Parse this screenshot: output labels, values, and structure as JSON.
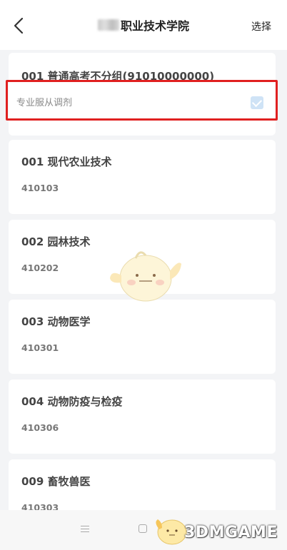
{
  "header": {
    "back_icon": "chevron-left-icon",
    "title": "职业技术学院",
    "select_label": "选择"
  },
  "group": {
    "name": "001 普通高考不分组(91010000000)",
    "adjust_label": "专业服从调剂",
    "adjust_checked": true
  },
  "majors": [
    {
      "name": "001 现代农业技术",
      "code": "410103"
    },
    {
      "name": "002 园林技术",
      "code": "410202"
    },
    {
      "name": "003 动物医学",
      "code": "410301"
    },
    {
      "name": "004 动物防疫与检疫",
      "code": "410306"
    },
    {
      "name": "009 畜牧兽医",
      "code": "410303"
    }
  ],
  "navbar": {
    "menu_icon": "menu-icon",
    "home_icon": "home-icon",
    "back_icon": "back-icon"
  },
  "watermark": "3DMGAME",
  "colors": {
    "highlight_border": "#e02020",
    "checkbox": "#cfe3f6",
    "background": "#f3f4f6"
  }
}
